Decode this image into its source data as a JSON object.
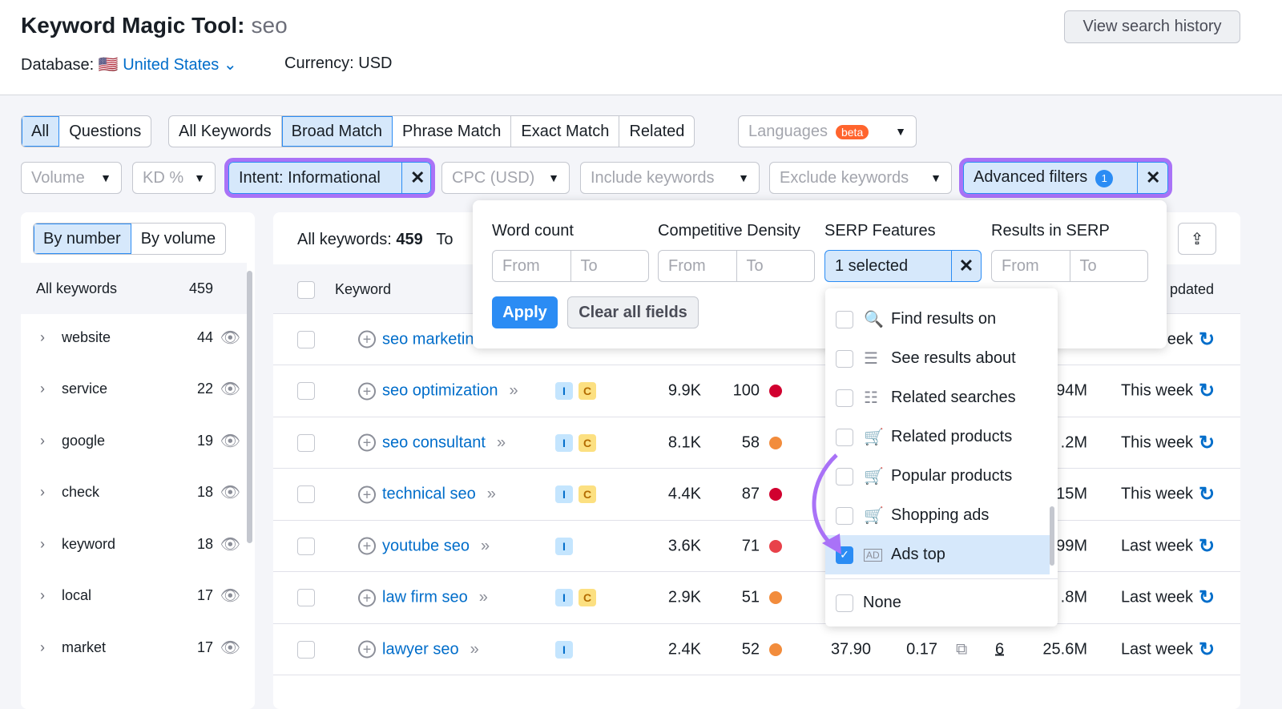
{
  "header": {
    "title": "Keyword Magic Tool:",
    "query": "seo",
    "database_label": "Database:",
    "database": "United States",
    "currency": "Currency: USD",
    "history_button": "View search history"
  },
  "tabs1": [
    "All",
    "Questions"
  ],
  "tabs2": [
    "All Keywords",
    "Broad Match",
    "Phrase Match",
    "Exact Match",
    "Related"
  ],
  "languages": {
    "label": "Languages",
    "badge": "beta"
  },
  "filters": {
    "volume": "Volume",
    "kd": "KD %",
    "intent": "Intent: Informational",
    "cpc": "CPC (USD)",
    "include": "Include keywords",
    "exclude": "Exclude keywords",
    "advanced": "Advanced filters",
    "advanced_count": "1"
  },
  "sidebar": {
    "by_number": "By number",
    "by_volume": "By volume",
    "all_label": "All keywords",
    "all_count": "459",
    "items": [
      {
        "name": "website",
        "count": "44"
      },
      {
        "name": "service",
        "count": "22"
      },
      {
        "name": "google",
        "count": "19"
      },
      {
        "name": "check",
        "count": "18"
      },
      {
        "name": "keyword",
        "count": "18"
      },
      {
        "name": "local",
        "count": "17"
      },
      {
        "name": "market",
        "count": "17"
      }
    ]
  },
  "table": {
    "summary_label": "All keywords:",
    "summary_count": "459",
    "summary_tail": "To",
    "header_keyword": "Keyword",
    "header_updated": "pdated",
    "rows": [
      {
        "keyword": "seo marketing",
        "updated": "eek"
      },
      {
        "keyword": "seo optimization",
        "intents": [
          "I",
          "C"
        ],
        "volume": "9.9K",
        "kd": "100",
        "kd_color": "#d1002f",
        "results": "94M",
        "updated": "This week"
      },
      {
        "keyword": "seo consultant",
        "intents": [
          "I",
          "C"
        ],
        "volume": "8.1K",
        "kd": "58",
        "kd_color": "#f28c3c",
        "results": ".2M",
        "updated": "This week"
      },
      {
        "keyword": "technical seo",
        "intents": [
          "I",
          "C"
        ],
        "volume": "4.4K",
        "kd": "87",
        "kd_color": "#d1002f",
        "results": "15M",
        "updated": "This week"
      },
      {
        "keyword": "youtube seo",
        "intents": [
          "I"
        ],
        "volume": "3.6K",
        "kd": "71",
        "kd_color": "#e8414a",
        "results": "99M",
        "updated": "Last week"
      },
      {
        "keyword": "law firm seo",
        "intents": [
          "I",
          "C"
        ],
        "volume": "2.9K",
        "kd": "51",
        "kd_color": "#f28c3c",
        "results": ".8M",
        "updated": "Last week"
      },
      {
        "keyword": "lawyer seo",
        "intents": [
          "I"
        ],
        "volume": "2.4K",
        "kd": "52",
        "kd_color": "#f28c3c",
        "cpc": "37.90",
        "com": "0.17",
        "serp_count": "6",
        "results": "25.6M",
        "updated": "Last week"
      }
    ]
  },
  "popup": {
    "word_count": "Word count",
    "comp_density": "Competitive Density",
    "serp_features": "SERP Features",
    "results_in_serp": "Results in SERP",
    "from": "From",
    "to": "To",
    "serp_value": "1 selected",
    "apply": "Apply",
    "clear": "Clear all fields"
  },
  "serp_menu": [
    {
      "label": "Find results on",
      "icon": "🔍",
      "checked": false
    },
    {
      "label": "See results about",
      "icon": "☰",
      "checked": false
    },
    {
      "label": "Related searches",
      "icon": "☷",
      "checked": false
    },
    {
      "label": "Related products",
      "icon": "🛒",
      "checked": false
    },
    {
      "label": "Popular products",
      "icon": "🛒",
      "checked": false
    },
    {
      "label": "Shopping ads",
      "icon": "🛒",
      "checked": false
    },
    {
      "label": "Ads top",
      "icon": "AD",
      "checked": true
    }
  ],
  "serp_none": "None",
  "colors": {
    "accent": "#2b8cf4",
    "highlight": "#a972f7",
    "link": "#006dca"
  }
}
